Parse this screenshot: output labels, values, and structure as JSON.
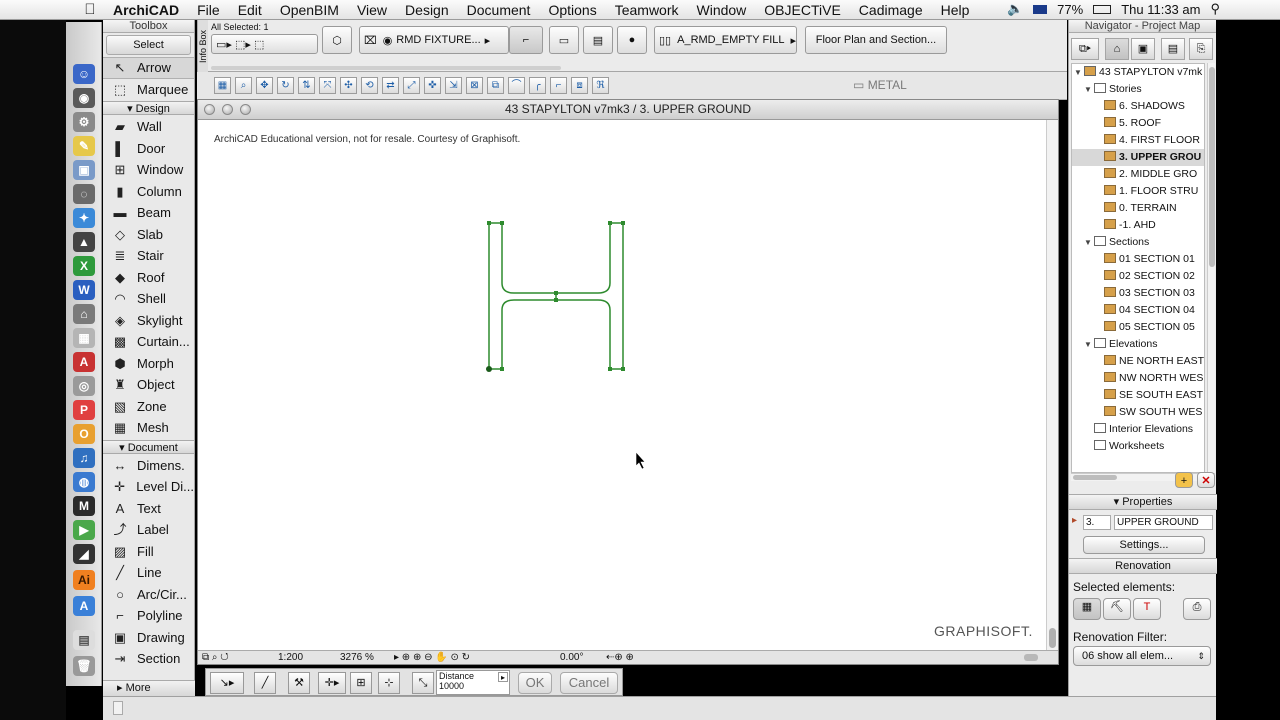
{
  "menubar": {
    "app_name": "ArchiCAD",
    "items": [
      "File",
      "Edit",
      "OpenBIM",
      "View",
      "Design",
      "Document",
      "Options",
      "Teamwork",
      "Window",
      "OBJECTiVE",
      "Cadimage",
      "Help"
    ],
    "battery": "77%",
    "clock": "Thu 11:33 am"
  },
  "toolbox": {
    "title": "Toolbox",
    "select_label": "Select",
    "tools_top": [
      {
        "label": "Arrow",
        "icon": "arrow-icon"
      },
      {
        "label": "Marquee",
        "icon": "marquee-icon"
      }
    ],
    "design_header": "Design",
    "design_tools": [
      {
        "label": "Wall",
        "icon": "wall-icon"
      },
      {
        "label": "Door",
        "icon": "door-icon"
      },
      {
        "label": "Window",
        "icon": "window-icon"
      },
      {
        "label": "Column",
        "icon": "column-icon"
      },
      {
        "label": "Beam",
        "icon": "beam-icon"
      },
      {
        "label": "Slab",
        "icon": "slab-icon"
      },
      {
        "label": "Stair",
        "icon": "stair-icon"
      },
      {
        "label": "Roof",
        "icon": "roof-icon"
      },
      {
        "label": "Shell",
        "icon": "shell-icon"
      },
      {
        "label": "Skylight",
        "icon": "skylight-icon"
      },
      {
        "label": "Curtain...",
        "icon": "curtain-wall-icon"
      },
      {
        "label": "Morph",
        "icon": "morph-icon"
      },
      {
        "label": "Object",
        "icon": "object-icon"
      },
      {
        "label": "Zone",
        "icon": "zone-icon"
      },
      {
        "label": "Mesh",
        "icon": "mesh-icon"
      }
    ],
    "document_header": "Document",
    "document_tools": [
      {
        "label": "Dimens.",
        "icon": "dimension-icon"
      },
      {
        "label": "Level Di...",
        "icon": "level-dimension-icon"
      },
      {
        "label": "Text",
        "icon": "text-icon"
      },
      {
        "label": "Label",
        "icon": "label-icon"
      },
      {
        "label": "Fill",
        "icon": "fill-icon"
      },
      {
        "label": "Line",
        "icon": "line-icon"
      },
      {
        "label": "Arc/Cir...",
        "icon": "arc-icon"
      },
      {
        "label": "Polyline",
        "icon": "polyline-icon"
      },
      {
        "label": "Drawing",
        "icon": "drawing-icon"
      },
      {
        "label": "Section",
        "icon": "section-icon"
      }
    ],
    "more_label": "More"
  },
  "infobox": {
    "side_label": "Info Box",
    "selection": "All Selected: 1",
    "layer_fixture": "RMD FIXTURE...",
    "fill_name": "A_RMD_EMPTY FILL",
    "display_option": "Floor Plan and Section..."
  },
  "toolrow": {
    "folder_label": "METAL"
  },
  "plan_window": {
    "title": "43 STAPYLTON v7mk3 / 3. UPPER GROUND",
    "edu_notice": "ArchiCAD Educational version, not for resale. Courtesy of Graphisoft.",
    "logo": "GRAPHISOFT."
  },
  "statusbar": {
    "scale": "1:200",
    "zoom": "3276 %",
    "angle": "0.00°"
  },
  "tracker": {
    "field_label": "Distance",
    "field_value": "10000",
    "ok_label": "OK",
    "cancel_label": "Cancel"
  },
  "navigator": {
    "title": "Navigator - Project Map",
    "tree": [
      {
        "label": "43 STAPYLTON v7mk",
        "indent": 0,
        "kind": "root",
        "open": true
      },
      {
        "label": "Stories",
        "indent": 1,
        "kind": "folder",
        "open": true
      },
      {
        "label": "6. SHADOWS",
        "indent": 2,
        "kind": "story"
      },
      {
        "label": "5. ROOF",
        "indent": 2,
        "kind": "story"
      },
      {
        "label": "4. FIRST FLOOR",
        "indent": 2,
        "kind": "story"
      },
      {
        "label": "3. UPPER GROU",
        "indent": 2,
        "kind": "story",
        "selected": true
      },
      {
        "label": "2. MIDDLE GRO",
        "indent": 2,
        "kind": "story"
      },
      {
        "label": "1. FLOOR STRU",
        "indent": 2,
        "kind": "story"
      },
      {
        "label": "0. TERRAIN",
        "indent": 2,
        "kind": "story"
      },
      {
        "label": "-1. AHD",
        "indent": 2,
        "kind": "story"
      },
      {
        "label": "Sections",
        "indent": 1,
        "kind": "folder",
        "open": true
      },
      {
        "label": "01 SECTION 01",
        "indent": 2,
        "kind": "section"
      },
      {
        "label": "02 SECTION 02",
        "indent": 2,
        "kind": "section"
      },
      {
        "label": "03 SECTION 03",
        "indent": 2,
        "kind": "section"
      },
      {
        "label": "04 SECTION 04",
        "indent": 2,
        "kind": "section"
      },
      {
        "label": "05 SECTION 05",
        "indent": 2,
        "kind": "section"
      },
      {
        "label": "Elevations",
        "indent": 1,
        "kind": "folder",
        "open": true
      },
      {
        "label": "NE NORTH EAST",
        "indent": 2,
        "kind": "elevation"
      },
      {
        "label": "NW NORTH WES",
        "indent": 2,
        "kind": "elevation"
      },
      {
        "label": "SE SOUTH EAST",
        "indent": 2,
        "kind": "elevation"
      },
      {
        "label": "SW SOUTH WES",
        "indent": 2,
        "kind": "elevation"
      },
      {
        "label": "Interior Elevations",
        "indent": 1,
        "kind": "folder"
      },
      {
        "label": "Worksheets",
        "indent": 1,
        "kind": "folder"
      }
    ],
    "properties_header": "Properties",
    "prop_id": "3.",
    "prop_name": "UPPER GROUND",
    "settings_label": "Settings...",
    "renovation_header": "Renovation",
    "selected_elements_label": "Selected elements:",
    "renovation_filter_label": "Renovation Filter:",
    "renovation_filter_value": "06 show all elem..."
  }
}
